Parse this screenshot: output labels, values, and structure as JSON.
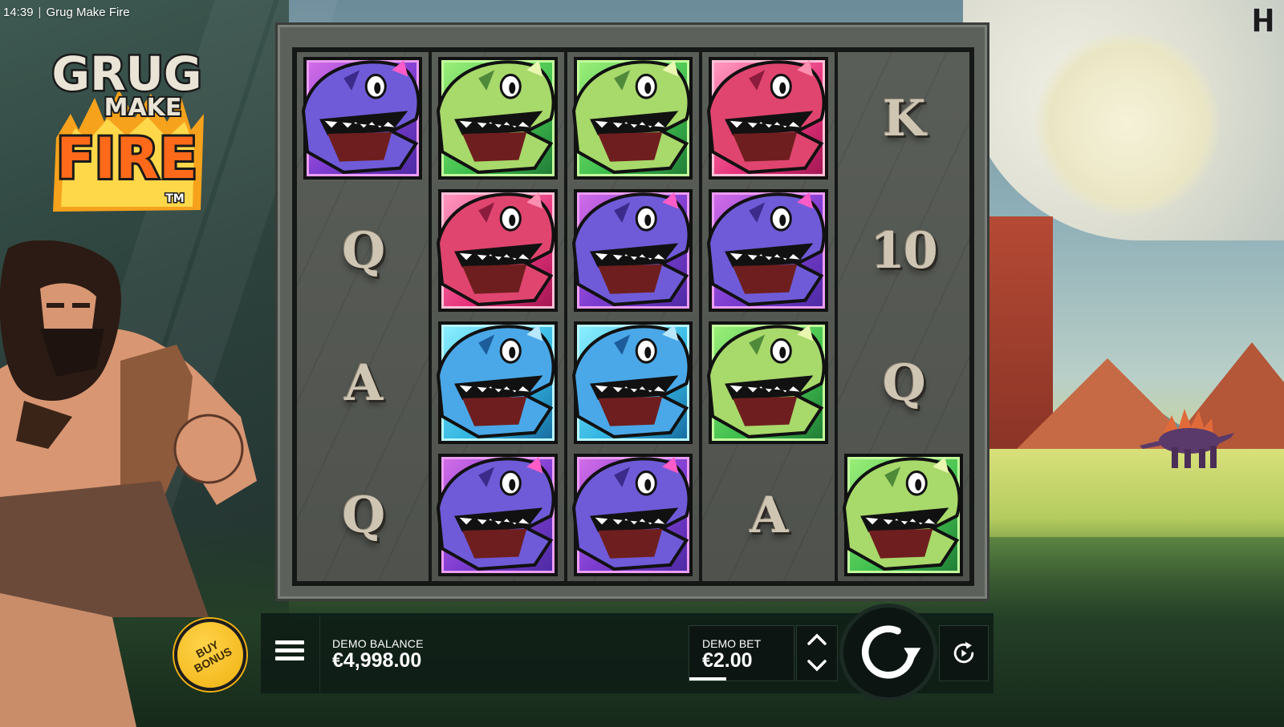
{
  "status_bar": {
    "time": "14:39",
    "separator": "|",
    "game_title": "Grug Make Fire"
  },
  "logo": {
    "line1": "GRUG",
    "line2": "MAKE",
    "line3": "FIRE",
    "mark": "TM"
  },
  "reels": [
    [
      "dino-purple",
      "letter-Q",
      "letter-A",
      "letter-Q"
    ],
    [
      "dino-green",
      "dino-red",
      "dino-blue",
      "dino-purple"
    ],
    [
      "dino-green",
      "dino-purple",
      "dino-blue",
      "dino-purple"
    ],
    [
      "dino-red",
      "dino-purple",
      "dino-green",
      "letter-A"
    ],
    [
      "letter-K",
      "letter-10",
      "letter-Q",
      "dino-green"
    ]
  ],
  "controls": {
    "buy_bonus_label": "BUY BONUS",
    "balance_label": "DEMO BALANCE",
    "balance_value": "€4,998.00",
    "bet_label": "DEMO BET",
    "bet_value": "€2.00",
    "bet_level_fraction": 0.35,
    "icons": {
      "menu": "hamburger-icon",
      "bet_up": "chevron-up-icon",
      "bet_down": "chevron-down-icon",
      "spin": "spin-arrow-icon",
      "autoplay": "autoplay-icon"
    }
  },
  "colors": {
    "buy_bonus": "#f0b211",
    "panel": "#0e1c16",
    "text": "#ffffff"
  }
}
